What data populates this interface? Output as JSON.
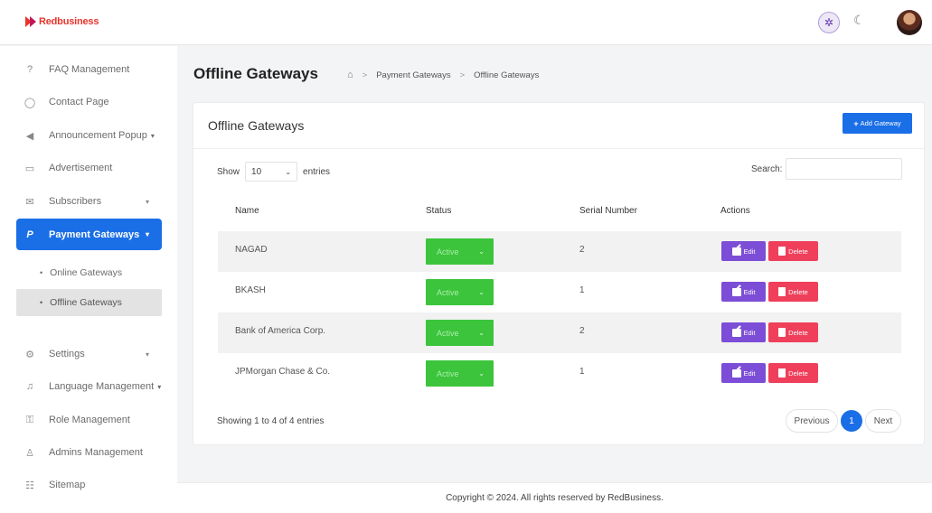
{
  "brand": {
    "name": "Redbusiness"
  },
  "header": {
    "theme_light_icon": "sun-icon",
    "theme_dark_icon": "moon-icon"
  },
  "sidebar": {
    "items": [
      {
        "label": "FAQ Management",
        "icon": "question-circle-icon"
      },
      {
        "label": "Contact Page",
        "icon": "whatsapp-icon"
      },
      {
        "label": "Announcement Popup",
        "icon": "megaphone-icon",
        "chevron": "▾"
      },
      {
        "label": "Advertisement",
        "icon": "ad-icon"
      },
      {
        "label": "Subscribers",
        "icon": "mail-icon",
        "chevron": "▾"
      },
      {
        "label": "Payment Gateways",
        "icon": "paypal-icon",
        "chevron": "▾"
      },
      {
        "label": "Settings",
        "icon": "gear-icon",
        "chevron": "▾"
      },
      {
        "label": "Language Management",
        "icon": "language-icon",
        "chevron": "▾"
      },
      {
        "label": "Role Management",
        "icon": "key-icon"
      },
      {
        "label": "Admins Management",
        "icon": "user-icon"
      },
      {
        "label": "Sitemap",
        "icon": "sitemap-icon"
      }
    ],
    "sub_items": [
      {
        "label": "Online Gateways"
      },
      {
        "label": "Offline Gateways"
      }
    ]
  },
  "page": {
    "title": "Offline Gateways",
    "breadcrumb": [
      "Payment Gateways",
      "Offline Gateways"
    ]
  },
  "card": {
    "title": "Offline Gateways",
    "add_button": "Add Gateway"
  },
  "table_controls": {
    "show_label": "Show",
    "entries_value": "10",
    "entries_label": "entries",
    "search_label": "Search:"
  },
  "table": {
    "columns": [
      "Name",
      "Status",
      "Serial Number",
      "Actions"
    ],
    "rows": [
      {
        "name": "NAGAD",
        "status": "Active",
        "serial": "2"
      },
      {
        "name": "BKASH",
        "status": "Active",
        "serial": "1"
      },
      {
        "name": "Bank of America Corp.",
        "status": "Active",
        "serial": "2"
      },
      {
        "name": "JPMorgan Chase & Co.",
        "status": "Active",
        "serial": "1"
      }
    ],
    "edit_label": "Edit",
    "delete_label": "Delete"
  },
  "pagination": {
    "info": "Showing 1 to 4 of 4 entries",
    "previous": "Previous",
    "current_page": "1",
    "next": "Next"
  },
  "footer": {
    "text": "Copyright © 2024. All rights reserved by RedBusiness."
  },
  "colors": {
    "primary": "#1a6ee6",
    "status_active": "#3cc43c",
    "edit": "#7c4dd6",
    "delete": "#ef3f5a",
    "brand": "#e8342b"
  }
}
